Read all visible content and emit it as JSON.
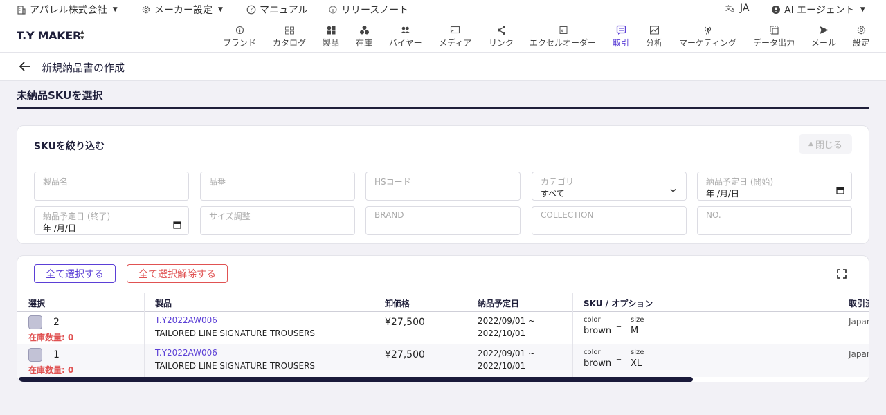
{
  "topbar": {
    "company": "アパレル株式会社",
    "maker_settings": "メーカー設定",
    "manual": "マニュアル",
    "release_notes": "リリースノート",
    "language": "JA",
    "ai_agent": "AI エージェント"
  },
  "navbar": {
    "brand": "T.Y MAKER",
    "items": [
      {
        "label": "ブランド",
        "icon": "info-icon"
      },
      {
        "label": "カタログ",
        "icon": "catalog-icon"
      },
      {
        "label": "製品",
        "icon": "product-icon"
      },
      {
        "label": "在庫",
        "icon": "stock-icon"
      },
      {
        "label": "バイヤー",
        "icon": "buyers-icon"
      },
      {
        "label": "メディア",
        "icon": "media-icon"
      },
      {
        "label": "リンク",
        "icon": "share-icon"
      },
      {
        "label": "エクセルオーダー",
        "icon": "excel-icon"
      },
      {
        "label": "取引",
        "icon": "transactions-icon"
      },
      {
        "label": "分析",
        "icon": "analytics-icon"
      },
      {
        "label": "マーケティング",
        "icon": "marketing-icon"
      },
      {
        "label": "データ出力",
        "icon": "export-icon"
      },
      {
        "label": "メール",
        "icon": "send-icon"
      },
      {
        "label": "設定",
        "icon": "gear-icon"
      }
    ],
    "active_index": 8,
    "active_color": "#5b3fd6"
  },
  "page": {
    "title": "新規納品書の作成",
    "section_title": "未納品SKUを選択"
  },
  "filter": {
    "title": "SKUを絞り込む",
    "close_label": "閉じる",
    "fields": [
      {
        "label": "製品名",
        "value": ""
      },
      {
        "label": "品番",
        "value": ""
      },
      {
        "label": "HSコード",
        "value": ""
      },
      {
        "label": "カテゴリ",
        "value": "すべて"
      },
      {
        "label": "納品予定日 (開始)",
        "value": "年 /月/日"
      },
      {
        "label": "納品予定日 (終了)",
        "value": "年 /月/日"
      },
      {
        "label": "サイズ調整",
        "value": ""
      },
      {
        "label": "BRAND",
        "value": ""
      },
      {
        "label": "COLLECTION",
        "value": ""
      },
      {
        "label": "NO.",
        "value": ""
      }
    ]
  },
  "table": {
    "select_all": "全て選択する",
    "deselect_all": "全て選択解除する",
    "columns": [
      "選択",
      "製品",
      "卸価格",
      "納品予定日",
      "SKU / オプション",
      "取引済"
    ],
    "rows": [
      {
        "num": "2",
        "stock": "在庫数量: 0",
        "code": "T.Y2022AW006",
        "name": "TAILORED LINE SIGNATURE TROUSERS",
        "price": "¥27,500",
        "date_start": "2022/09/01 ~",
        "date_end": "2022/10/01",
        "opt1_label": "color",
        "opt1_value": "brown",
        "opt2_label": "size",
        "opt2_value": "M",
        "country": "Japan"
      },
      {
        "num": "1",
        "stock": "在庫数量: 0",
        "code": "T.Y2022AW006",
        "name": "TAILORED LINE SIGNATURE TROUSERS",
        "price": "¥27,500",
        "date_start": "2022/09/01 ~",
        "date_end": "2022/10/01",
        "opt1_label": "color",
        "opt1_value": "brown",
        "opt2_label": "size",
        "opt2_value": "XL",
        "country": "Japan"
      }
    ]
  }
}
